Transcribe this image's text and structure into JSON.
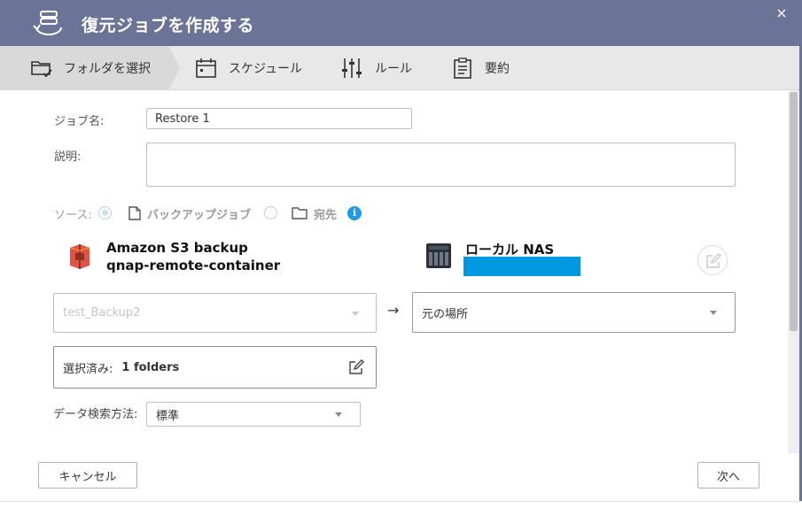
{
  "dialog": {
    "title": "復元ジョブを作成する",
    "close_glyph": "×"
  },
  "steps": [
    {
      "label": "フォルダを選択",
      "icon": "folder-check-icon",
      "active": true
    },
    {
      "label": "スケジュール",
      "icon": "calendar-icon",
      "active": false
    },
    {
      "label": "ルール",
      "icon": "sliders-icon",
      "active": false
    },
    {
      "label": "要約",
      "icon": "clipboard-icon",
      "active": false
    }
  ],
  "form": {
    "job_name_label": "ジョブ名:",
    "job_name_value": "Restore 1",
    "description_label": "説明:",
    "description_value": "",
    "source_label": "ソース:",
    "source_options": [
      "バックアップジョブ",
      "宛先"
    ],
    "source_selected": "バックアップジョブ",
    "info_glyph": "i"
  },
  "source": {
    "name": "Amazon S3 backup",
    "container": "qnap-remote-container",
    "job_select_value": "test_Backup2"
  },
  "destination": {
    "name": "ローカル NAS",
    "location_select_value": "元の場所"
  },
  "arrow_glyph": "→",
  "selection": {
    "label": "選択済み:",
    "value": "1 folders"
  },
  "search_method": {
    "label": "データ検索方法:",
    "value": "標準"
  },
  "buttons": {
    "cancel": "キャンセル",
    "next": "次へ"
  },
  "colors": {
    "titlebar": "#6b7396",
    "accent_blue": "#0098e0",
    "info_blue": "#1e9be6"
  }
}
